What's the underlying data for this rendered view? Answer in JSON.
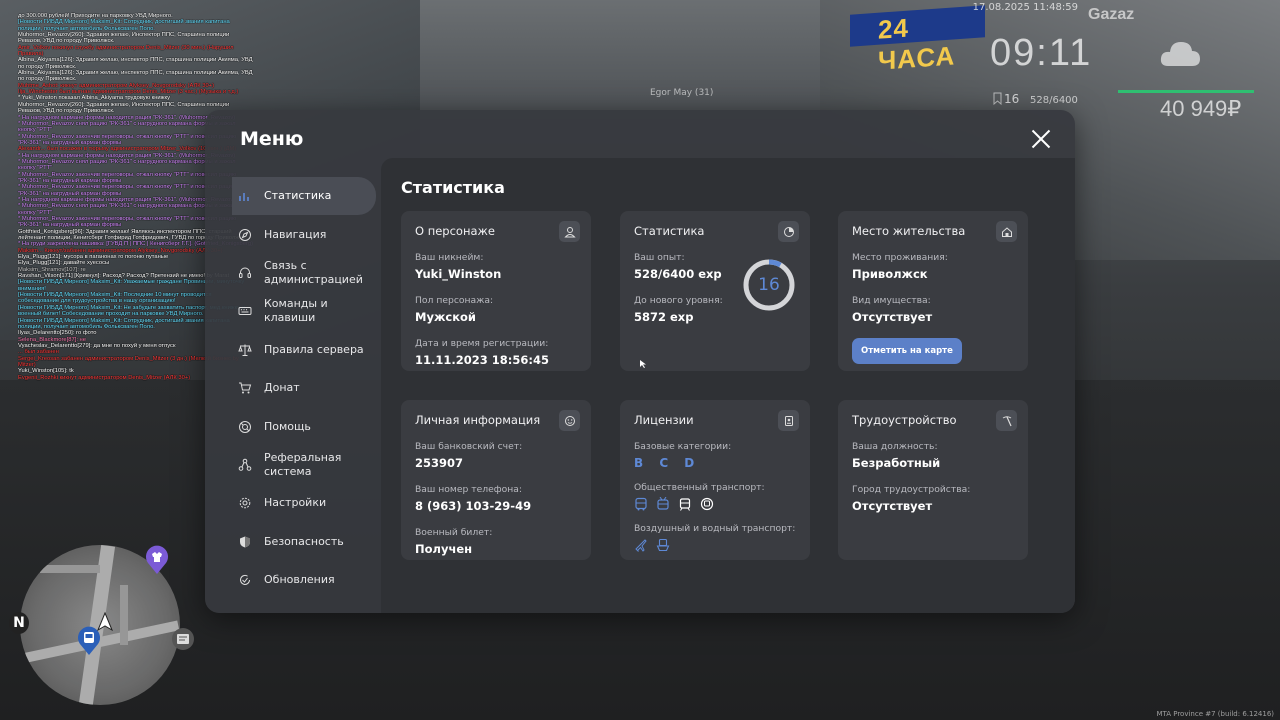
{
  "hud": {
    "datetime": "17.08.2025 11:48:59",
    "clock": "09:11",
    "level": "16",
    "exp": "528/6400",
    "money": "40 949₽",
    "player_tag": "Egor May (31)",
    "build": "MTA Province #7 (build: 6.12416)",
    "health_color": "#2fbf71",
    "scene_banner": "24 ЧАСА",
    "scene_brand": "Gazaz",
    "minimap_north": "N"
  },
  "chat": [
    {
      "text": "до 300.000 рублей! Приходите на парковку УВД Мирного.",
      "color": "#ffffff"
    },
    {
      "text": "[Новости ГИБДД Мирного] Maksim_Kit: Сотрудник, достигший звания капитана полиции, получает автомобиль Фольксваген Поло.",
      "color": "#66e0ff"
    },
    {
      "text": "Muhormor_Revazov[260]: Здравия желаю, Инспектор ППС, Старшина полиции Ревазов, УВД по городу Приволжск.",
      "color": "#ffffff"
    },
    {
      "text": "Amir_Volkov покинул службу администратором Denis_Mitzer (30 мин.) (Нарушил Правила)",
      "color": "#ff3b3b"
    },
    {
      "text": "Albina_Akiyama[126]: Здравия желаю, инспектор ППС, старшина полиции Акияма, УВД по городу Приволжск.",
      "color": "#ffffff"
    },
    {
      "text": "Albina_Akiyama[126]: Здравия желаю, инспектор ППС, старшина полиции Акияма, УВД по городу Приволжск.",
      "color": "#ffffff"
    },
    {
      "text": "Muhtme_Ashot: кикнут администратором Alyksey_Novgorodsky (АЛК 30+)",
      "color": "#ff3b3b"
    },
    {
      "text": "Ilja_Winchester был выгнан администратором Denis_Mitzer (3 час.) (Музыка и т.д.)",
      "color": "#ff3b3b"
    },
    {
      "text": "* Yuki_Winston показал Albina_Akiyama трудовую книжку",
      "color": "#ffffff"
    },
    {
      "text": "Muhormor_Revazov[260]: Здравия желаю, Инспектор ППС, Старшина полиции Ревазов, УВД по городу Приволжск.",
      "color": "#ffffff"
    },
    {
      "text": "* На нагрудном кармане формы находится рация \"РК-361\". (Muhormor_Revazov)",
      "color": "#d58bff"
    },
    {
      "text": "* Muhormor_Revazov снял рацию \"РК-361\" с нагрудного кармана формы и зажал кнопку \"PTT\"",
      "color": "#d58bff"
    },
    {
      "text": "* Muhormor_Revazov закончив переговоры, отжал кнопку \"PTT\" и повесил рацию \"РК-361\" на нагрудный карман формы",
      "color": "#d58bff"
    },
    {
      "text": "Alexandr... был посажен в тюрьму администратором Mitzer_Volkov (10 мин.) (ДМ)",
      "color": "#ff3b3b"
    },
    {
      "text": "* На нагрудном кармане формы находится рация \"РК-361\". (Muhormor_Revazov)",
      "color": "#d58bff"
    },
    {
      "text": "* Muhormor_Revazov снял рацию \"РК-361\" с нагрудного кармана формы и зажал кнопку \"PTT\"",
      "color": "#d58bff"
    },
    {
      "text": "* Muhormor_Revazov закончив переговоры, отжал кнопку \"PTT\" и повесил рацию \"РК-361\" на нагрудный карман формы",
      "color": "#d58bff"
    },
    {
      "text": "* Muhormor_Revazov закончив переговоры, отжал кнопку \"PTT\" и повесил рацию \"РК-361\" на нагрудный карман формы",
      "color": "#d58bff"
    },
    {
      "text": "* На нагрудном кармане формы находится рация \"РК-361\". (Muhormor_Revazov)",
      "color": "#d58bff"
    },
    {
      "text": "* Muhormor_Revazov снял рацию \"РК-361\" с нагрудного кармана формы и зажал кнопку \"PTT\"",
      "color": "#d58bff"
    },
    {
      "text": "* Muhormor_Revazov закончив переговоры, отжал кнопку \"PTT\" и повесил рацию \"РК-361\" на нагрудный карман формы",
      "color": "#d58bff"
    },
    {
      "text": "Gottfried_Konigsberg[96]: Здравия желаю! Являюсь инспектором ППС, старший лейтенант полиции, Кенигсберг Готфирид Готфридович, ГУВД по городу Приволжск.",
      "color": "#ffffff"
    },
    {
      "text": "* На груди закреплена нашивка: [ГУВД П | ППС | Кенигсберг Г.Г.]. (Gottfried_Konigsberg)",
      "color": "#d58bff"
    },
    {
      "text": "Maksim... Кикнут/забанен администратором Alyksey_Novgorodsky (АЛК 30+)",
      "color": "#ff3b3b"
    },
    {
      "text": "Elya_Plugg[121]: мусора в паганонах го погоню путаные",
      "color": "#ffffff"
    },
    {
      "text": "Elya_Plugg[121]: давайте хуесосы",
      "color": "#ffffff"
    },
    {
      "text": "Maksim_Shramov[107]: ге",
      "color": "#cccccc"
    },
    {
      "text": "Ravshan_Vilson[171] [Крикнул]: Расход? Расход? Претензий не имею! by Marat",
      "color": "#ffffff"
    },
    {
      "text": "[Новости ГИБДД Мирного] Maksim_Kit: Уважаемые граждане Провинции, минуточку внимания!",
      "color": "#66e0ff"
    },
    {
      "text": "[Новости ГИБДД Мирного] Maksim_Kit: Последние 10 минут проводится собеседование для трудоустройства в нашу организацию!",
      "color": "#66e0ff"
    },
    {
      "text": "[Новости ГИБДД Мирного] Maksim_Kit: Не забудьте захватить паспорт, мед.книжку и военный билет! Собеседование проходит на парковке УВД Мирного.",
      "color": "#66e0ff"
    },
    {
      "text": "[Новости ГИБДД Мирного] Maksim_Kit: Сотрудник, достигший звания капитана полиции, получает автомобиль Фольксваген Поло.",
      "color": "#66e0ff"
    },
    {
      "text": "Ilyas_Delarentto[250]: го фото",
      "color": "#ffffff"
    },
    {
      "text": "Selena_Blackmore[87]: не",
      "color": "#ff7ab0"
    },
    {
      "text": "Vyacheslav_Delarentto[279]: да мне по похуй у меня отпуск",
      "color": "#ffffff"
    },
    {
      "text": "... был забанен",
      "color": "#ff3b3b"
    },
    {
      "text": "Sergei_Kreosan забанен администратором Denis_Mitzer (3 дн.) (Мелкий бизнес by Mitzer)",
      "color": "#ff3b3b"
    },
    {
      "text": "Yuki_Winston[105]: tk",
      "color": "#ffffff"
    },
    {
      "text": "Evgenii_Rozhki кикнут администратором Denis_Mitzer (АЛК 30+)",
      "color": "#ff3b3b"
    }
  ],
  "menu": {
    "title": "Меню",
    "close_icon": "close-icon",
    "nav": [
      {
        "label": "Статистика",
        "icon": "chart-icon",
        "active": true
      },
      {
        "label": "Навигация",
        "icon": "compass-icon"
      },
      {
        "label": "Связь с администрацией",
        "icon": "headset-icon"
      },
      {
        "label": "Команды и клавиши",
        "icon": "keyboard-icon"
      },
      {
        "label": "Правила сервера",
        "icon": "scales-icon"
      },
      {
        "label": "Донат",
        "icon": "cart-icon"
      },
      {
        "label": "Помощь",
        "icon": "help-icon"
      },
      {
        "label": "Реферальная система",
        "icon": "referral-icon"
      },
      {
        "label": "Настройки",
        "icon": "gear-icon"
      },
      {
        "label": "Безопасность",
        "icon": "shield-icon"
      },
      {
        "label": "Обновления",
        "icon": "update-icon"
      }
    ]
  },
  "content": {
    "title": "Статистика",
    "accent": "#5e89d6",
    "card_character": {
      "title": "О персонаже",
      "nickname_label": "Ваш никнейм:",
      "nickname": "Yuki_Winston",
      "gender_label": "Пол персонажа:",
      "gender": "Мужской",
      "reg_label": "Дата и время регистрации:",
      "reg": "11.11.2023 18:56:45"
    },
    "card_stats": {
      "title": "Статистика",
      "exp_label": "Ваш опыт:",
      "exp": "528/6400 exp",
      "next_label": "До нового уровня:",
      "next": "5872 exp",
      "level": "16",
      "progress": 0.0825
    },
    "card_residence": {
      "title": "Место жительства",
      "place_label": "Место проживания:",
      "place": "Приволжск",
      "property_label": "Вид имущества:",
      "property": "Отсутствует",
      "button": "Отметить на карте"
    },
    "card_personal": {
      "title": "Личная информация",
      "bank_label": "Ваш банковский счет:",
      "bank": "253907",
      "phone_label": "Ваш номер телефона:",
      "phone": "8 (963) 103-29-49",
      "military_label": "Военный билет:",
      "military": "Получен"
    },
    "card_licenses": {
      "title": "Лицензии",
      "base_label": "Базовые категории:",
      "categories": "B C D",
      "public_label": "Общественный транспорт:",
      "air_label": "Воздушный и водный транспорт:"
    },
    "card_job": {
      "title": "Трудоустройство",
      "position_label": "Ваша должность:",
      "position": "Безработный",
      "company_label": "Город трудоустройства:",
      "company": "Отсутствует"
    }
  }
}
